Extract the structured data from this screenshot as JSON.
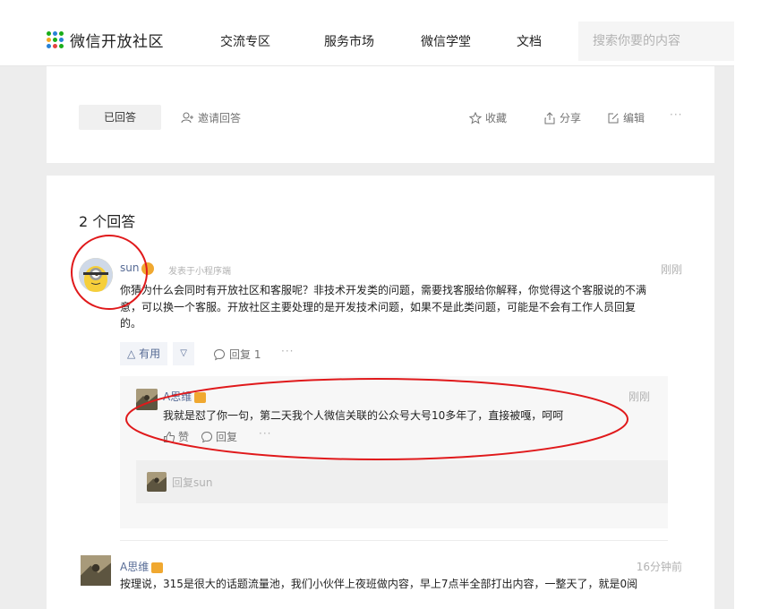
{
  "header": {
    "logo_text": "微信开放社区",
    "nav": [
      "交流专区",
      "服务市场",
      "微信学堂",
      "文档"
    ],
    "search_placeholder": "搜索你要的内容"
  },
  "question_bar": {
    "answered_label": "已回答",
    "invite_label": "邀请回答",
    "favorite_label": "收藏",
    "share_label": "分享",
    "edit_label": "编辑",
    "more_label": "···"
  },
  "answers": {
    "count_label": "2 个回答",
    "first": {
      "author": "sun",
      "meta": "发表于小程序端",
      "time": "刚刚",
      "lines": [
        "你猜为什么会同时有开放社区和客服呢？非技术开发类的问题，需要找客服给你解释，你觉得这个客服说的不满",
        "意，可以换一个客服。开放社区主要处理的是开发技术问题，如果不是此类问题，可能是不会有工作人员回复",
        "的。"
      ],
      "useful_label": "有用",
      "down_label": "▽",
      "reply_label": "回复 1",
      "more_label": "···",
      "comment": {
        "author": "A思维",
        "time": "刚刚",
        "text": "我就是怼了你一句，第二天我个人微信关联的公众号大号10多年了，直接被嘎，呵呵",
        "like_label": "赞",
        "reply_label": "回复",
        "more_label": "···",
        "reply_placeholder": "回复sun"
      }
    },
    "second": {
      "author": "A思维",
      "time": "16分钟前",
      "text": "按理说，315是很大的话题流量池，我们小伙伴上夜班做内容，早上7点半全部打出内容，一整天了，就是0阅"
    }
  },
  "colors": {
    "link_blue": "#576b95",
    "annotation_red": "#e0191b",
    "badge_orange": "#f0a830"
  }
}
